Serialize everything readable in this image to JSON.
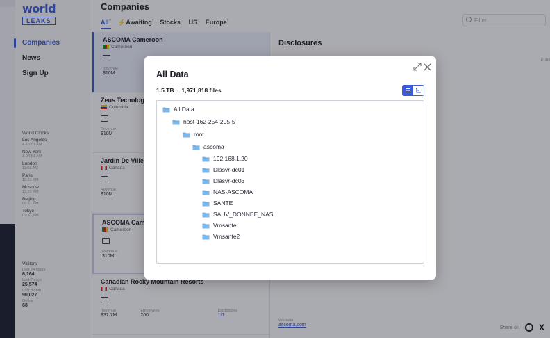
{
  "sidebar": {
    "logo_top": "world",
    "logo_bottom": "LEAKS",
    "nav": [
      "Companies",
      "News",
      "Sign Up"
    ],
    "clocks_header": "World Clocks",
    "clocks": [
      {
        "city": "Los Angeles",
        "time": "& 10:51 AM"
      },
      {
        "city": "New York",
        "time": "& 04:51 AM"
      },
      {
        "city": "London",
        "time": "11:51 AM"
      },
      {
        "city": "Paris",
        "time": "12:51 PM"
      },
      {
        "city": "Moscow",
        "time": "13:51 PM"
      },
      {
        "city": "Beijing",
        "time": "06:51 PM"
      },
      {
        "city": "Tokyo",
        "time": "07:51 PM"
      }
    ],
    "visitors_header": "Visitors",
    "visitors": [
      {
        "label": "Last 24 hours",
        "value": "6,164"
      },
      {
        "label": "Last 7 days",
        "value": "25,574"
      },
      {
        "label": "Last month",
        "value": "90,027"
      },
      {
        "label": "Online",
        "value": "68"
      }
    ]
  },
  "main": {
    "title": "Companies",
    "tabs": [
      {
        "label": "All",
        "sup": "¹⁰"
      },
      {
        "label": "Awaiting",
        "sup": "³"
      },
      {
        "label": "Stocks",
        "sup": "¹"
      },
      {
        "label": "US",
        "sup": "¹"
      },
      {
        "label": "Europe",
        "sup": "²"
      }
    ],
    "filter_placeholder": "Filter",
    "cards": [
      {
        "name": "ASCOMA Cameroon",
        "country": "Cameroon",
        "rev_label": "Revenue",
        "rev": "$10M",
        "emp_label": "",
        "emp": ""
      },
      {
        "name": "Zeus Tecnologia",
        "country": "Colombia",
        "rev_label": "Revenue",
        "rev": "$10M",
        "emp_label": "",
        "emp": ""
      },
      {
        "name": "Jardin De Ville",
        "country": "Canada",
        "rev_label": "Revenue",
        "rev": "$10M",
        "emp_label": "",
        "emp": ""
      },
      {
        "name": "ASCOMA Cameroon",
        "country": "Cameroon",
        "rev_label": "Revenue",
        "rev": "$10M",
        "emp_label": "",
        "emp": ""
      },
      {
        "name": "Canadian Rocky Mountain Resorts",
        "country": "Canada",
        "rev_label": "Revenue",
        "rev": "$37.7M",
        "emp_label": "Employees",
        "emp": "200",
        "disc_label": "Disclosures",
        "disc": "1/1"
      }
    ],
    "detail_title": "Disclosures",
    "published_label": "Publi",
    "website_label": "Website",
    "website_value": "ascoma.com",
    "share_label": "Share on"
  },
  "modal": {
    "title": "All Data",
    "size": "1.5 TB",
    "files": "1,971,818 files",
    "tree": {
      "root": "All Data",
      "host": "host-162-254-205-5",
      "root_dir": "root",
      "ascoma": "ascoma",
      "children": [
        "192.168.1.20",
        "Dlasvr-dc01",
        "Dlasvr-dc03",
        "NAS-ASCOMA",
        "SANTE",
        "SAUV_DONNEE_NAS",
        "Vmsante",
        "Vmsante2"
      ]
    },
    "colors": {
      "accent": "#3d5bd9",
      "folder": "#7fb6e8"
    }
  }
}
